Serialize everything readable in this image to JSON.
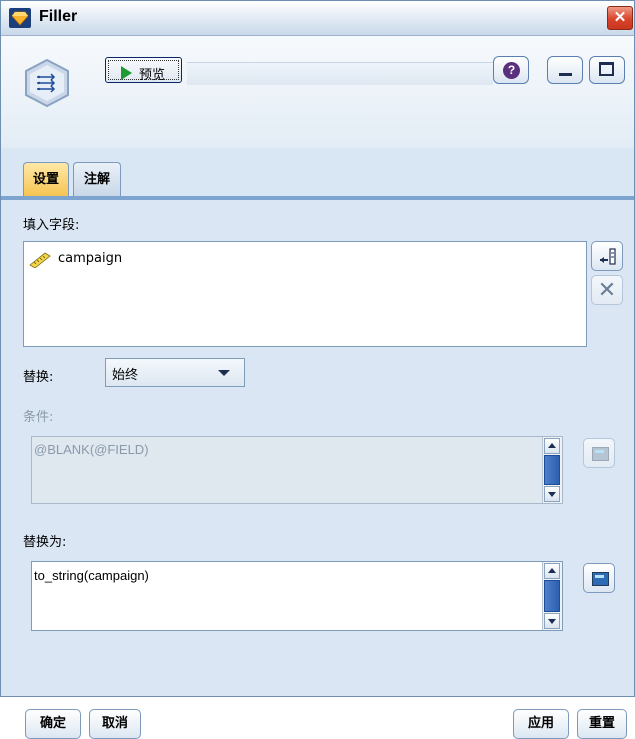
{
  "window": {
    "title": "Filler",
    "close_label": "✕"
  },
  "toolbar": {
    "preview_label": "预览",
    "help_glyph": "?"
  },
  "tabs": [
    {
      "label": "设置",
      "active": true
    },
    {
      "label": "注解",
      "active": false
    }
  ],
  "fill_fields": {
    "label": "填入字段:",
    "items": [
      {
        "name": "campaign",
        "icon": "ruler-icon"
      }
    ]
  },
  "replace": {
    "label": "替换:",
    "selected": "始终"
  },
  "condition": {
    "label": "条件:",
    "value": "@BLANK(@FIELD)",
    "disabled": true
  },
  "replace_with": {
    "label": "替换为:",
    "value": "to_string(campaign)"
  },
  "footer": {
    "ok": "确定",
    "cancel": "取消",
    "apply": "应用",
    "reset": "重置"
  },
  "colors": {
    "active_tab": "#f6c452",
    "accent": "#7da4cf",
    "panel": "#dae6f3"
  }
}
